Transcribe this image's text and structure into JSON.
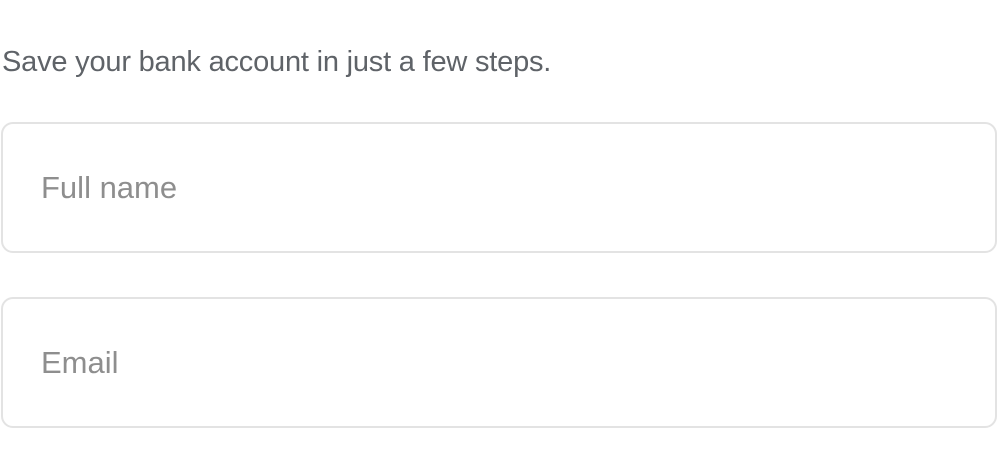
{
  "form": {
    "subtitle": "Save your bank account in just a few steps.",
    "fields": [
      {
        "placeholder": "Full name",
        "value": ""
      },
      {
        "placeholder": "Email",
        "value": ""
      }
    ]
  },
  "colors": {
    "subtitle_text": "#5f6368",
    "placeholder_text": "#8e8e8e",
    "field_border": "#e3e3e3",
    "background": "#ffffff"
  }
}
